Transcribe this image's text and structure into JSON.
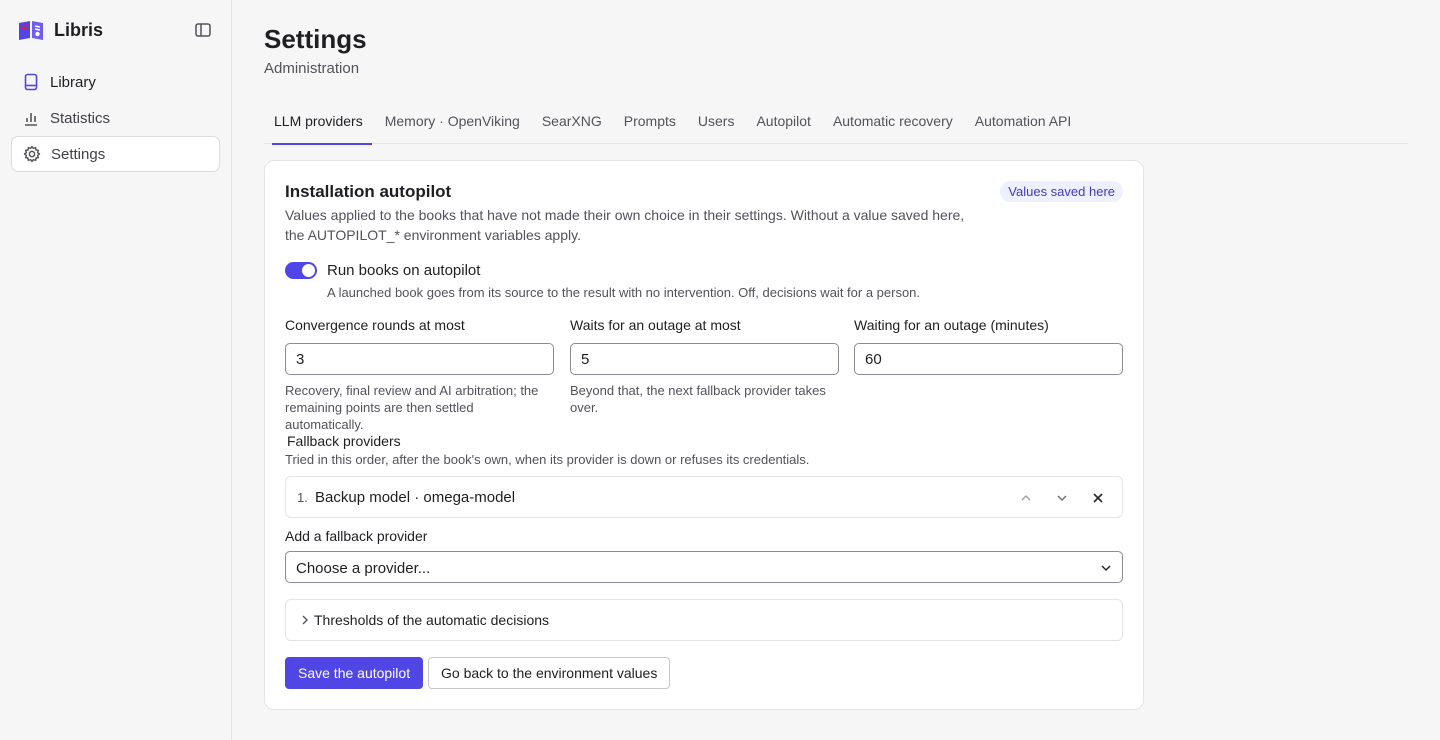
{
  "app": {
    "name": "Libris",
    "logo_icon": "open-book-logo-icon",
    "collapse_icon": "sidebar-toggle-icon"
  },
  "sidebar": {
    "items": [
      {
        "label": "Library",
        "icon": "book-icon"
      },
      {
        "label": "Statistics",
        "icon": "bar-chart-icon"
      },
      {
        "label": "Settings",
        "icon": "gear-icon",
        "active": true
      }
    ]
  },
  "page": {
    "title": "Settings",
    "subtitle": "Administration"
  },
  "tabs": [
    {
      "label": "LLM providers",
      "active": true
    },
    {
      "label": "Memory · OpenViking"
    },
    {
      "label": "SearXNG"
    },
    {
      "label": "Prompts"
    },
    {
      "label": "Users"
    },
    {
      "label": "Autopilot"
    },
    {
      "label": "Automatic recovery"
    },
    {
      "label": "Automation API"
    }
  ],
  "card": {
    "title": "Installation autopilot",
    "description": "Values applied to the books that have not made their own choice in their settings. Without a value saved here, the AUTOPILOT_* environment variables apply.",
    "badge": "Values saved here",
    "toggle": {
      "label": "Run books on autopilot",
      "help": "A launched book goes from its source to the result with no intervention. Off, decisions wait for a person.",
      "on": true
    },
    "fields": [
      {
        "label": "Convergence rounds at most",
        "value": "3",
        "help": "Recovery, final review and AI arbitration; the remaining points are then settled automatically."
      },
      {
        "label": "Waits for an outage at most",
        "value": "5",
        "help": "Beyond that, the next fallback provider takes over."
      },
      {
        "label": "Waiting for an outage (minutes)",
        "value": "60",
        "help": ""
      }
    ],
    "fallback": {
      "heading": "Fallback providers",
      "help": "Tried in this order, after the book's own, when its provider is down or refuses its credentials.",
      "items": [
        {
          "index": "1.",
          "label": "Backup model · omega-model"
        }
      ],
      "item_icons": {
        "up": "chevron-up-icon",
        "down": "chevron-down-icon",
        "remove": "close-icon"
      }
    },
    "add_fallback": {
      "label": "Add a fallback provider",
      "selected": "Choose a provider..."
    },
    "thresholds": {
      "label": "Thresholds of the automatic decisions",
      "expanded": false
    },
    "buttons": {
      "save": "Save the autopilot",
      "reset": "Go back to the environment values"
    }
  },
  "colors": {
    "accent": "#4f46e5",
    "badge_bg": "#eef0ff",
    "badge_text": "#4338ca",
    "background": "#f6f6f7"
  }
}
